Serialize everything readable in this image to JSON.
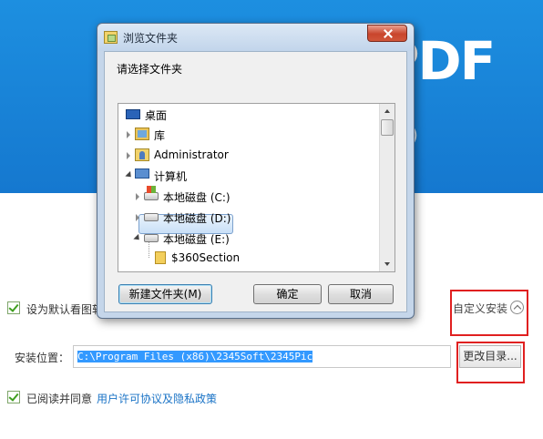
{
  "installer": {
    "banner_logo": "PDF",
    "banner_version": "5 )",
    "default_viewer_label": "设为默认看图软件",
    "custom_install_label": "自定义安装",
    "install_location_label": "安装位置：",
    "install_path_value": "C:\\Program Files (x86)\\2345Soft\\2345Pic",
    "change_dir_button": "更改目录...",
    "agree_text": "已阅读并同意",
    "license_link": "用户许可协议及隐私政策",
    "accent_color": "#1d8fe0",
    "highlight_color": "#e02020"
  },
  "dialog": {
    "title": "浏览文件夹",
    "prompt": "请选择文件夹",
    "tree": [
      {
        "label": "桌面",
        "icon": "desktop-icon",
        "level": 0,
        "expander": "none"
      },
      {
        "label": "库",
        "icon": "library-icon",
        "level": 1,
        "expander": "collapsed"
      },
      {
        "label": "Administrator",
        "icon": "user-folder-icon",
        "level": 1,
        "expander": "collapsed"
      },
      {
        "label": "计算机",
        "icon": "computer-icon",
        "level": 1,
        "expander": "expanded"
      },
      {
        "label": "本地磁盘 (C:)",
        "icon": "system-drive-icon",
        "level": 2,
        "expander": "collapsed"
      },
      {
        "label": "本地磁盘 (D:)",
        "icon": "drive-icon",
        "level": 2,
        "expander": "collapsed"
      },
      {
        "label": "本地磁盘 (E:)",
        "icon": "drive-icon",
        "level": 2,
        "expander": "expanded",
        "selected": true
      },
      {
        "label": "$360Section",
        "icon": "folder-icon",
        "level": 3,
        "expander": "none"
      }
    ],
    "new_folder_button": "新建文件夹(M)",
    "ok_button": "确定",
    "cancel_button": "取消"
  }
}
